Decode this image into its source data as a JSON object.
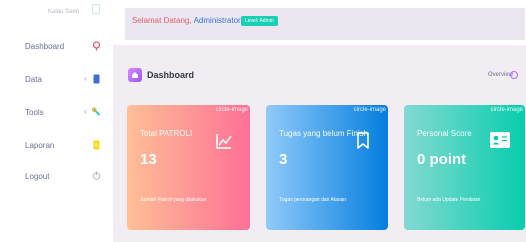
{
  "sidebar": {
    "top_text": "Kalau Saeri",
    "items": [
      {
        "label": "Dashboard",
        "icon": "home-icon",
        "color": "#e65c6a"
      },
      {
        "label": "Data",
        "icon": "file-icon",
        "color": "#3b6fd6",
        "arrow": "‹"
      },
      {
        "label": "Tools",
        "icon": "wrench-icon",
        "color": "#1bcfb4",
        "arrow": "‹"
      },
      {
        "label": "Laporan",
        "icon": "document-icon",
        "color": "#fed713"
      },
      {
        "label": "Logout",
        "icon": "power-icon",
        "color": "#b5b8c5"
      }
    ]
  },
  "header": {
    "welcome": "Selamat Datang,",
    "user": "Administrator",
    "role": "Level: Admin",
    "accent_color": "#e65c6a",
    "user_color": "#3b6fd6"
  },
  "page": {
    "title": "Dashboard",
    "overview": "Overview",
    "icon": "home-icon"
  },
  "cards": [
    {
      "image_alt": "circle-image",
      "label": "Total PATROLI",
      "value": "13",
      "note": "Jumlah Patroli yang dilakukan",
      "icon": "chart-line-icon",
      "gradient": [
        "#ffbf96",
        "#fe7096"
      ]
    },
    {
      "image_alt": "circle-image",
      "label": "Tugas yang belum Finish",
      "value": "3",
      "note": "Tugas perorangan dari Atasan",
      "icon": "bookmark-icon",
      "gradient": [
        "#90caf9",
        "#047edf"
      ]
    },
    {
      "image_alt": "circle-image",
      "label": "Personal Score",
      "value": "0 point",
      "note": "Belum ada Update Penilaian",
      "icon": "id-card-icon",
      "gradient": [
        "#84d9d2",
        "#07cdae"
      ]
    }
  ]
}
